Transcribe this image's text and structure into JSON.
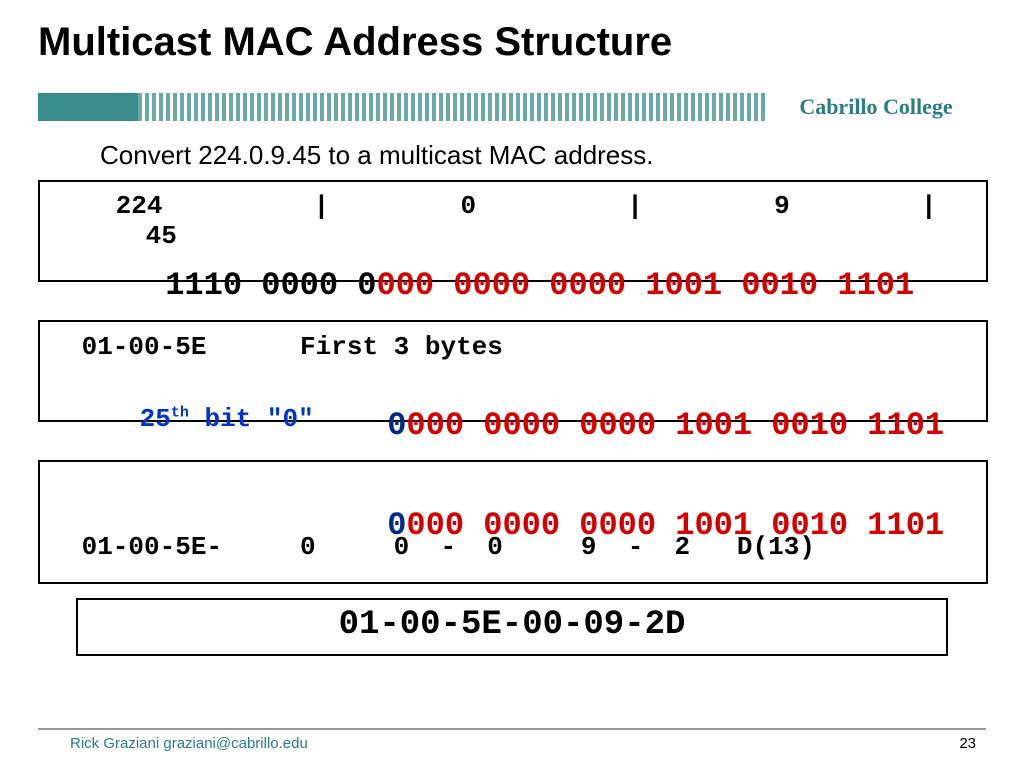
{
  "title": "Multicast MAC Address Structure",
  "brand": "Cabrillo College",
  "subtitle": "Convert 224.0.9.45 to a multicast MAC address.",
  "box1": {
    "ip_o1": "224",
    "sep": "|",
    "ip_o2": "0",
    "ip_o3": "9",
    "ip_o4": "45",
    "bin_black": "1110 0000 0",
    "bin_red": "000 0000 0000 1001 0010 1101"
  },
  "box2": {
    "line1": " 01-00-5E      First 3 bytes",
    "label_pre": "25",
    "label_sup": "th",
    "label_post": " bit \"0\"",
    "lead_bit": "0",
    "rest_bits": "000 0000 0000 1001 0010 1101"
  },
  "box3": {
    "lead_bit": "0",
    "rest_bits": "000 0000 0000 1001 0010 1101",
    "hex_line": " 01-00-5E-     0     0  -  0     9  -  2   D(13)"
  },
  "box4": {
    "result_main": "01-00-5E-00-09-2",
    "result_last": "D"
  },
  "footer": {
    "left": "Rick Graziani  graziani@cabrillo.edu",
    "right": "23"
  }
}
